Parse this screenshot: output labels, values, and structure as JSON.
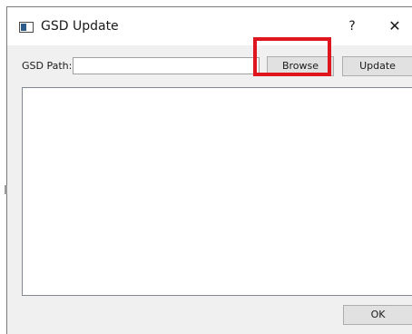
{
  "window": {
    "title": "GSD Update",
    "help_label": "?",
    "close_label": "✕",
    "icon": "application-window-icon"
  },
  "form": {
    "path_label": "GSD Path:",
    "path_value": "",
    "path_placeholder": ""
  },
  "buttons": {
    "browse_label": "Browse",
    "update_label": "Update",
    "ok_label": "OK"
  },
  "log": {
    "content": ""
  },
  "annotation": {
    "highlight_color": "#e0161e",
    "highlight_target": "Browse"
  }
}
